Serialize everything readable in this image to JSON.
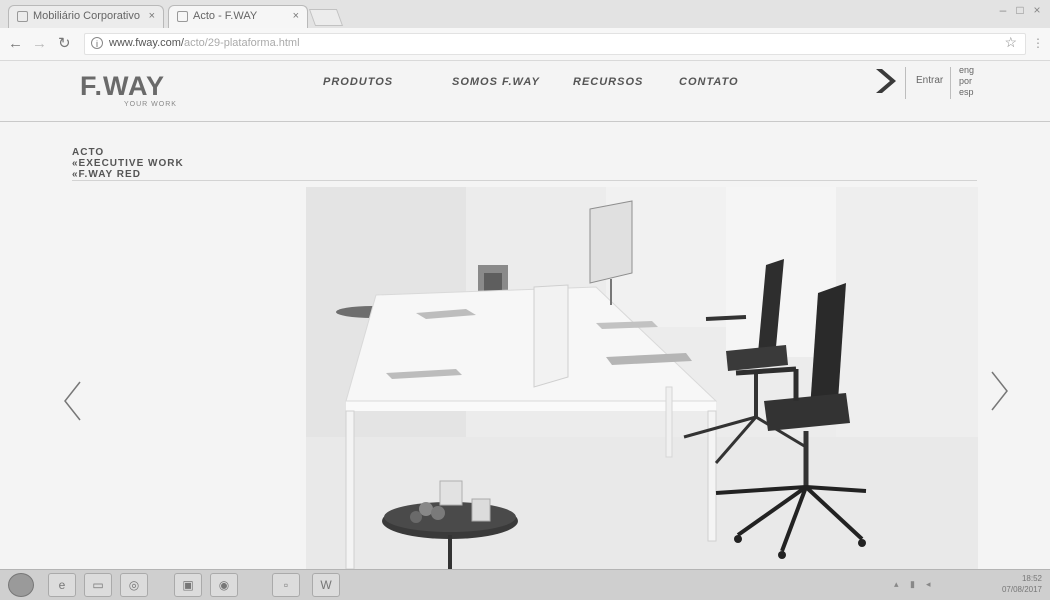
{
  "browser": {
    "tabs": [
      {
        "title": "Mobiliário Corporativo",
        "close": "×"
      },
      {
        "title": "Acto - F.WAY",
        "close": "×"
      }
    ],
    "window_controls": {
      "minimize": "–",
      "maximize": "□",
      "close": "×"
    },
    "url": {
      "host": "www.fway.com/",
      "path": "acto/29-plataforma.html"
    }
  },
  "header": {
    "logo": "F.WAY",
    "tagline": "YOUR WORK",
    "nav": [
      "PRODUTOS",
      "SOMOS F.WAY",
      "RECURSOS",
      "CONTATO"
    ],
    "login": "Entrar",
    "languages": [
      "eng",
      "por",
      "esp"
    ]
  },
  "breadcrumb": [
    "ACTO",
    "«EXECUTIVE WORK",
    "«F.WAY RED"
  ],
  "hero": {
    "image": "office-desk-with-two-chairs"
  },
  "taskbar": {
    "clock_time": "18:52",
    "clock_date": "07/08/2017"
  },
  "colors": {
    "text": "#555555",
    "background": "#f4f4f4",
    "accent": "#3a3a3a"
  }
}
